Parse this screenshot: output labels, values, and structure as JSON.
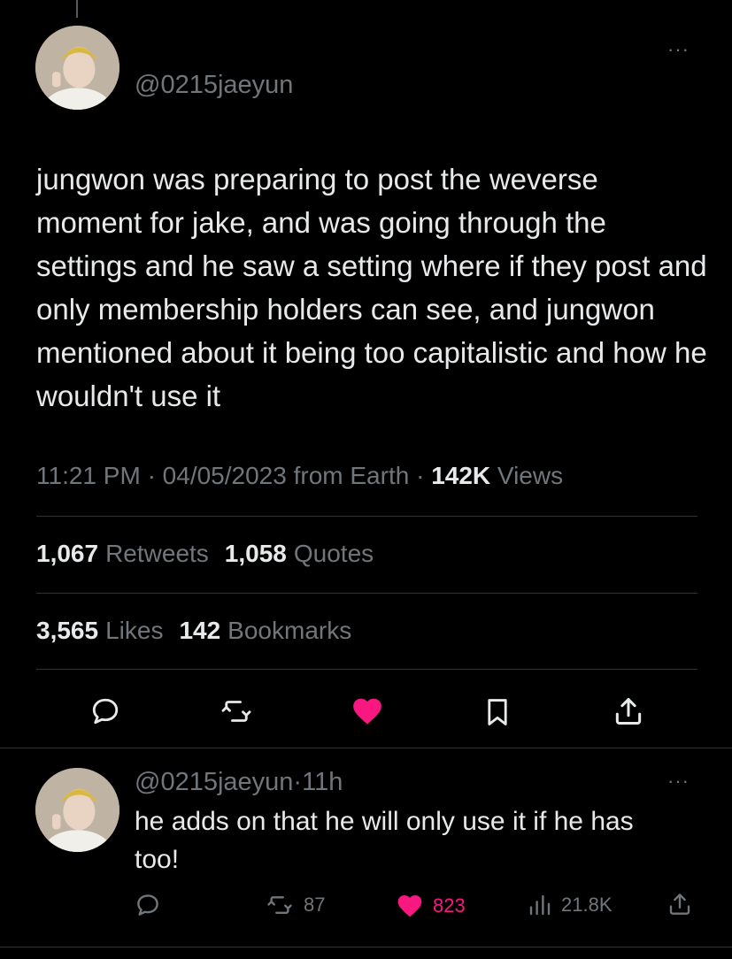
{
  "tweet": {
    "handle": "@0215jaeyun",
    "text": "jungwon was preparing to post the weverse moment for jake, and was going through the settings and he saw a setting where if they post and only membership holders can see, and jungwon mentioned about it being too capitalistic and how he wouldn't use it",
    "time": "11:21 PM",
    "date": "04/05/2023",
    "source": "from Earth",
    "separator": "·",
    "views_count": "142K",
    "views_label": "Views",
    "retweets_count": "1,067",
    "retweets_label": "Retweets",
    "quotes_count": "1,058",
    "quotes_label": "Quotes",
    "likes_count": "3,565",
    "likes_label": "Likes",
    "bookmarks_count": "142",
    "bookmarks_label": "Bookmarks",
    "more": "···"
  },
  "reply": {
    "handle": "@0215jaeyun",
    "separator": "·",
    "time": "11h",
    "text": "he adds on that he will only use it if he has too!",
    "retweets": "87",
    "likes": "823",
    "views": "21.8K",
    "more": "···"
  },
  "colors": {
    "background": "#000000",
    "text": "#e7e9ea",
    "secondary": "#71767b",
    "like": "#f91880",
    "divider": "#2f3336"
  },
  "icons": {
    "reply": "speech-bubble",
    "retweet": "retweet-arrows",
    "like": "heart-filled",
    "bookmark": "bookmark",
    "share": "share-upload",
    "views": "bar-chart",
    "more": "ellipsis"
  }
}
